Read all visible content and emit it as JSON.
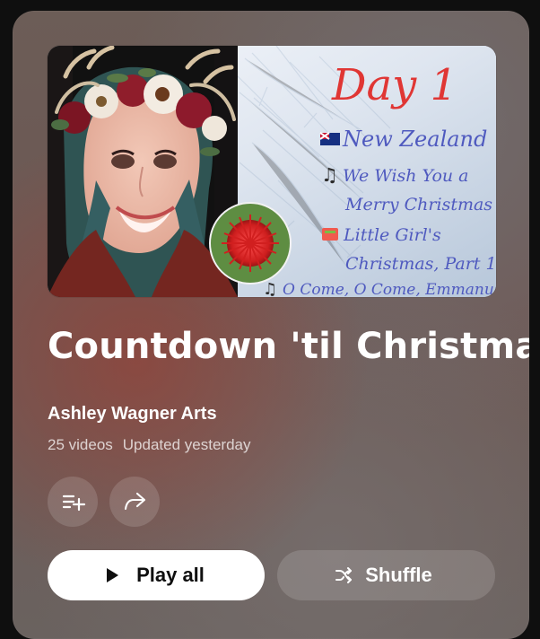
{
  "panel": {
    "colors": {
      "accent_dark": "#0f0f0f",
      "button_white": "#ffffff"
    }
  },
  "thumbnail": {
    "day_title": "Day 1",
    "lines": [
      "New Zealand",
      "We Wish You a",
      "Merry Christmas",
      "Little Girl's",
      "Christmas, Part 1",
      "O Come, O Come, Emmanuel"
    ]
  },
  "playlist": {
    "title": "Countdown 'til Christmas",
    "channel": "Ashley Wagner Arts",
    "video_count": "25 videos",
    "updated": "Updated yesterday"
  },
  "actions": {
    "save_icon": "playlist-add-icon",
    "share_icon": "share-icon",
    "play_all": "Play all",
    "shuffle": "Shuffle"
  }
}
